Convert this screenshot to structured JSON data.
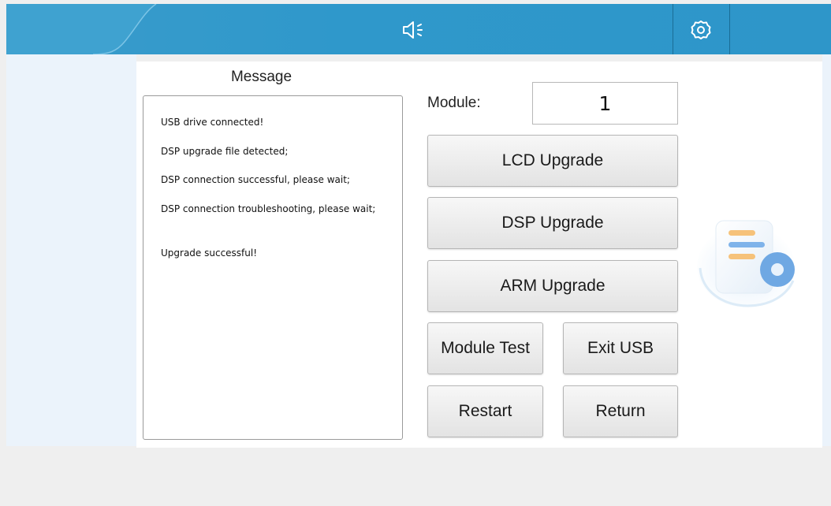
{
  "topbar": {
    "sound_icon": "speaker-icon",
    "settings_icon": "gear-icon",
    "accent_color": "#2e96c9"
  },
  "message": {
    "title": "Message",
    "lines": [
      "USB drive connected!",
      "DSP upgrade file detected;",
      "DSP connection successful, please wait;",
      "DSP connection troubleshooting, please wait;",
      "Upgrade successful!"
    ]
  },
  "module": {
    "label": "Module:",
    "value": "1"
  },
  "buttons": {
    "lcd_upgrade": "LCD Upgrade",
    "dsp_upgrade": "DSP Upgrade",
    "arm_upgrade": "ARM Upgrade",
    "module_test": "Module Test",
    "exit_usb": "Exit USB",
    "restart": "Restart",
    "return": "Return"
  },
  "decoration": {
    "icon": "document-settings-icon"
  }
}
